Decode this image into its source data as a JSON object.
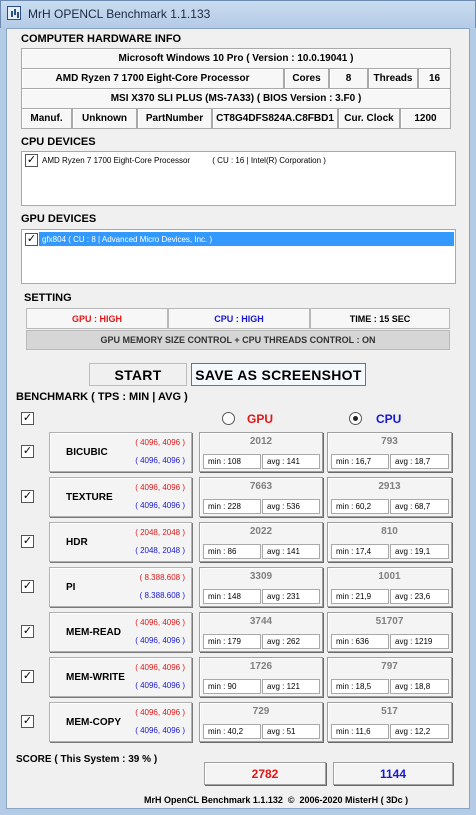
{
  "window": {
    "title": "MrH OPENCL Benchmark 1.1.133"
  },
  "hardware": {
    "section_title": "COMPUTER HARDWARE INFO",
    "os": "Microsoft Windows 10 Pro ( Version : 10.0.19041 )",
    "cpu_name": "AMD Ryzen 7 1700 Eight-Core Processor",
    "cores_label": "Cores",
    "cores_value": "8",
    "threads_label": "Threads",
    "threads_value": "16",
    "board": "MSI X370 SLI PLUS (MS-7A33) ( BIOS Version : 3.F0 )",
    "manuf_label": "Manuf.",
    "manuf_value": "Unknown",
    "part_label": "PartNumber",
    "part_value": "CT8G4DFS824A.C8FBD1",
    "clock_label": "Cur. Clock",
    "clock_value": "1200"
  },
  "cpu_devices": {
    "section_title": "CPU DEVICES",
    "items": [
      {
        "text": "AMD Ryzen 7 1700 Eight-Core Processor          ( CU : 16 | Intel(R) Corporation )",
        "checked": true
      }
    ]
  },
  "gpu_devices": {
    "section_title": "GPU DEVICES",
    "items": [
      {
        "text": "gfx804 ( CU : 8 | Advanced Micro Devices, Inc. )",
        "checked": true
      }
    ]
  },
  "setting": {
    "section_title": "SETTING",
    "gpu": "GPU : HIGH",
    "cpu": "CPU : HIGH",
    "time": "TIME : 15 SEC",
    "memory_control": "GPU MEMORY SIZE CONTROL + CPU THREADS CONTROL : ON"
  },
  "buttons": {
    "start": "START",
    "screenshot": "SAVE AS SCREENSHOT"
  },
  "benchmark": {
    "section_title": "BENCHMARK ( TPS : MIN | AVG )",
    "gpu_label": "GPU",
    "cpu_label": "CPU",
    "gpu_selected": false,
    "cpu_selected": true,
    "rows": [
      {
        "name": "BICUBIC",
        "gpu_res": "( 4096, 4096 )",
        "cpu_res": "( 4096, 4096 )",
        "gpu_score": "2012",
        "gpu_min": "min : 108",
        "gpu_avg": "avg : 141",
        "cpu_score": "793",
        "cpu_min": "min : 16,7",
        "cpu_avg": "avg : 18,7"
      },
      {
        "name": "TEXTURE",
        "gpu_res": "( 4096, 4096 )",
        "cpu_res": "( 4096, 4096 )",
        "gpu_score": "7663",
        "gpu_min": "min : 228",
        "gpu_avg": "avg : 536",
        "cpu_score": "2913",
        "cpu_min": "min : 60,2",
        "cpu_avg": "avg : 68,7"
      },
      {
        "name": "HDR",
        "gpu_res": "( 2048, 2048 )",
        "cpu_res": "( 2048, 2048 )",
        "gpu_score": "2022",
        "gpu_min": "min : 86",
        "gpu_avg": "avg : 141",
        "cpu_score": "810",
        "cpu_min": "min : 17,4",
        "cpu_avg": "avg : 19,1"
      },
      {
        "name": "PI",
        "gpu_res": "( 8.388.608 )",
        "cpu_res": "( 8.388.608 )",
        "gpu_score": "3309",
        "gpu_min": "min : 148",
        "gpu_avg": "avg : 231",
        "cpu_score": "1001",
        "cpu_min": "min : 21,9",
        "cpu_avg": "avg : 23,6"
      },
      {
        "name": "MEM-READ",
        "gpu_res": "( 4096, 4096 )",
        "cpu_res": "( 4096, 4096 )",
        "gpu_score": "3744",
        "gpu_min": "min : 179",
        "gpu_avg": "avg : 262",
        "cpu_score": "51707",
        "cpu_min": "min : 636",
        "cpu_avg": "avg : 1219"
      },
      {
        "name": "MEM-WRITE",
        "gpu_res": "( 4096, 4096 )",
        "cpu_res": "( 4096, 4096 )",
        "gpu_score": "1726",
        "gpu_min": "min : 90",
        "gpu_avg": "avg : 121",
        "cpu_score": "797",
        "cpu_min": "min : 18,5",
        "cpu_avg": "avg : 18,8"
      },
      {
        "name": "MEM-COPY",
        "gpu_res": "( 4096, 4096 )",
        "cpu_res": "( 4096, 4096 )",
        "gpu_score": "729",
        "gpu_min": "min : 40,2",
        "gpu_avg": "avg : 51",
        "cpu_score": "517",
        "cpu_min": "min : 11,6",
        "cpu_avg": "avg : 12,2"
      }
    ]
  },
  "score": {
    "label": "SCORE ( This System : 39 % )",
    "gpu_total": "2782",
    "cpu_total": "1144"
  },
  "footer": {
    "text": "MrH OpenCL Benchmark 1.1.132  ©  2006-2020 MisterH ( 3Dc )"
  },
  "colors": {
    "accent_red": "#e01818",
    "accent_blue": "#1818d0",
    "selection": "#3399ff"
  }
}
